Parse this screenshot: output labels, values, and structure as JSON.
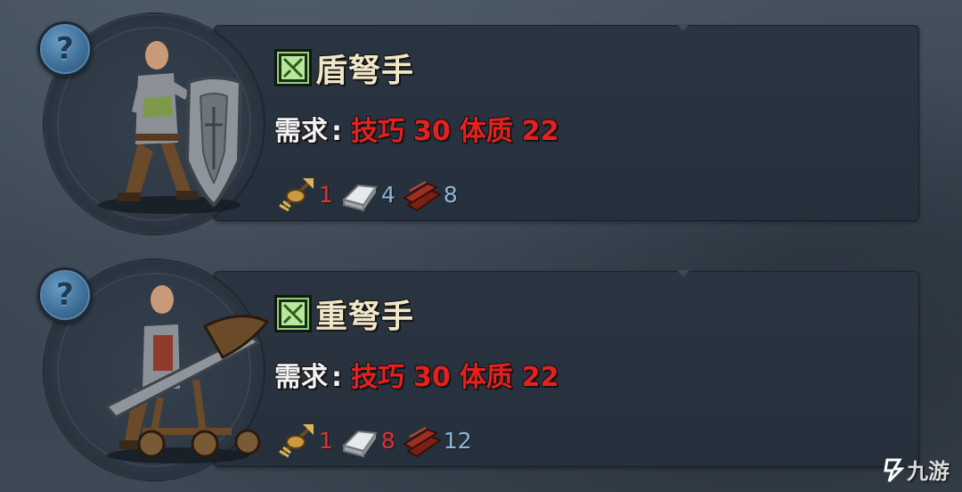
{
  "units": [
    {
      "name": "盾弩手",
      "requirement": {
        "label": "需求",
        "separator": ":",
        "stats": [
          {
            "name": "技巧",
            "value": "30"
          },
          {
            "name": "体质",
            "value": "22"
          }
        ]
      },
      "costs": [
        {
          "icon": "crossbow-bolt-icon",
          "amount": "1",
          "color": "#e53232"
        },
        {
          "icon": "iron-ingot-icon",
          "amount": "4",
          "color": "#8fb6d6"
        },
        {
          "icon": "wood-planks-icon",
          "amount": "8",
          "color": "#8fb6d6"
        }
      ],
      "figure": "shield-crossbowman-figure"
    },
    {
      "name": "重弩手",
      "requirement": {
        "label": "需求",
        "separator": ":",
        "stats": [
          {
            "name": "技巧",
            "value": "30"
          },
          {
            "name": "体质",
            "value": "22"
          }
        ]
      },
      "costs": [
        {
          "icon": "crossbow-bolt-icon",
          "amount": "1",
          "color": "#e53232"
        },
        {
          "icon": "iron-ingot-icon",
          "amount": "8",
          "color": "#e53232"
        },
        {
          "icon": "wood-planks-icon",
          "amount": "12",
          "color": "#8fb6d6"
        }
      ],
      "figure": "heavy-crossbowman-figure"
    }
  ],
  "help_glyph": "?",
  "watermark": {
    "text": "九游"
  },
  "colors": {
    "requirement_red": "#e5201f",
    "insufficient_red": "#e53232",
    "sufficient_blue": "#8fb6d6",
    "class_icon_green": "#8fd27a",
    "name_cream": "#f1e7c8"
  }
}
